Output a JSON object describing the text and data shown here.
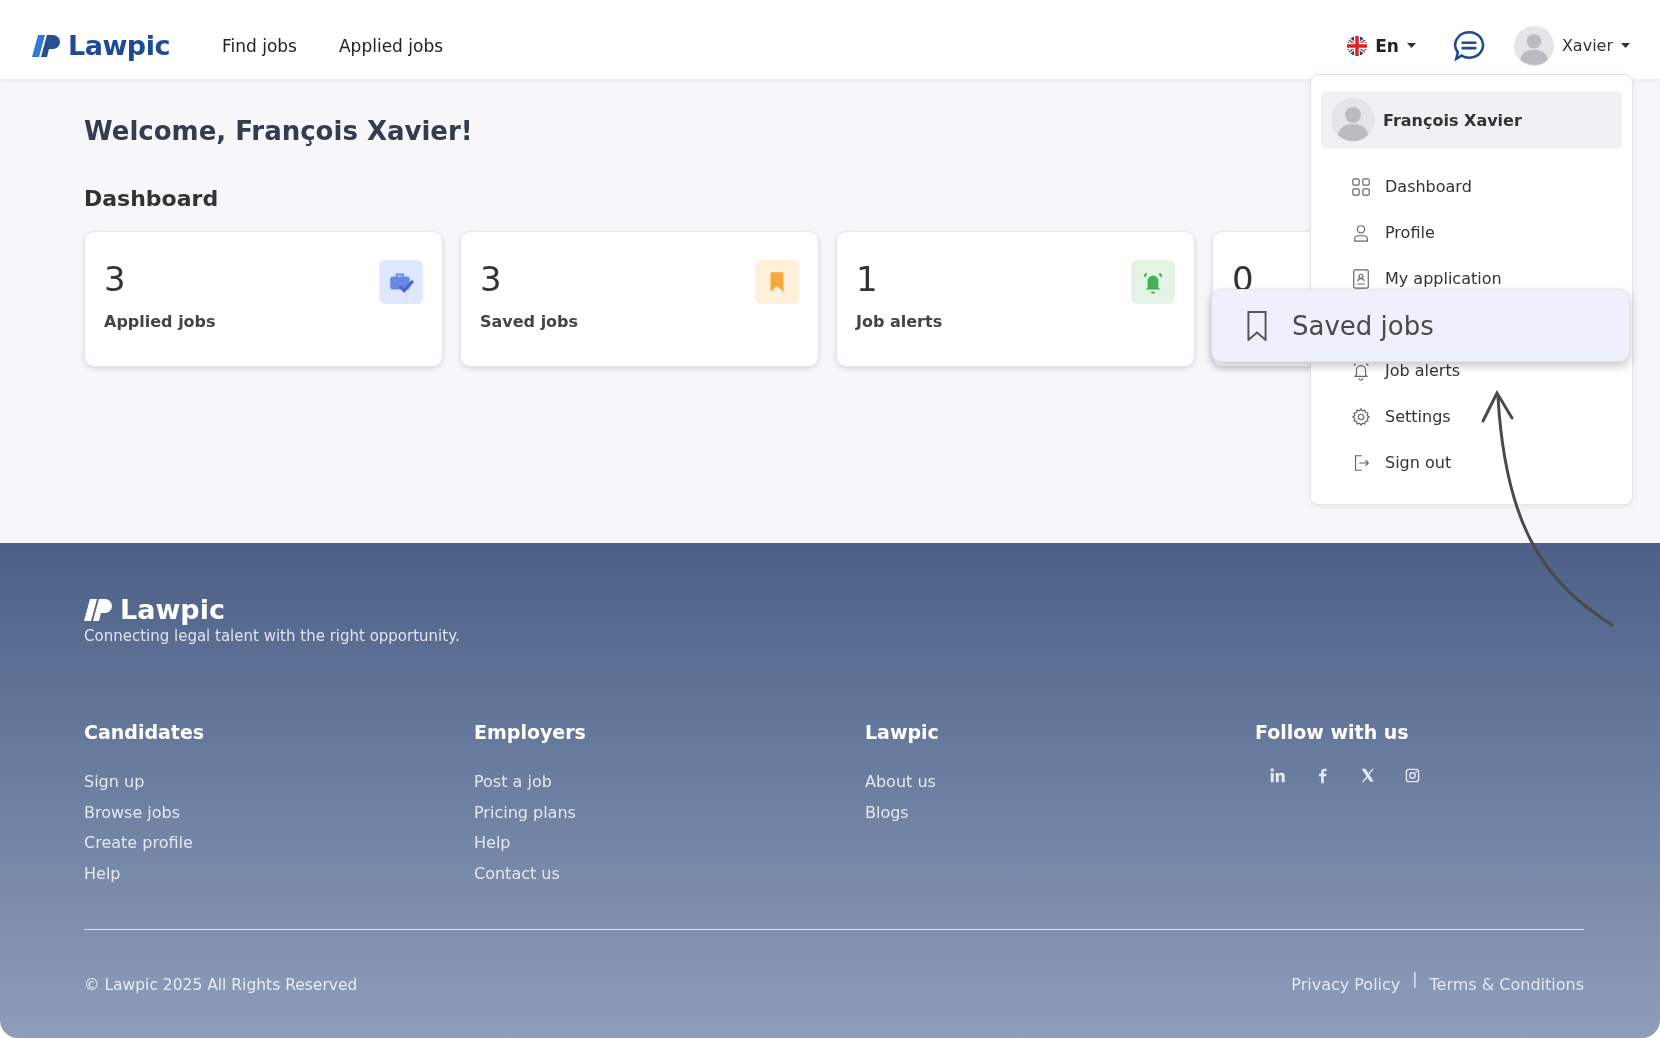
{
  "header": {
    "logo": "Lawpic",
    "nav": [
      "Find jobs",
      "Applied jobs"
    ],
    "language": "En",
    "user_name": "Xavier"
  },
  "welcome": "Welcome, François Xavier!",
  "dashboard": {
    "title": "Dashboard",
    "cards": [
      {
        "value": "3",
        "label": "Applied jobs",
        "kind": "briefcase"
      },
      {
        "value": "3",
        "label": "Saved jobs",
        "kind": "bookmark"
      },
      {
        "value": "1",
        "label": "Job alerts",
        "kind": "bell"
      },
      {
        "value": "0"
      }
    ]
  },
  "user_menu": {
    "name": "François Xavier",
    "items": [
      {
        "label": "Dashboard",
        "kind": "grid"
      },
      {
        "label": "Profile",
        "kind": "person"
      },
      {
        "label": "My application",
        "kind": "document"
      },
      {
        "kind": "hidden"
      },
      {
        "label": "Job alerts",
        "kind": "bell"
      },
      {
        "label": "Settings",
        "kind": "gear"
      },
      {
        "label": "Sign out",
        "kind": "exit"
      }
    ]
  },
  "callout": {
    "label": "Saved jobs"
  },
  "footer": {
    "logo": "Lawpic",
    "tagline": "Connecting legal talent with the right opportunity.",
    "columns": [
      {
        "title": "Candidates",
        "links": [
          "Sign up",
          "Browse jobs",
          "Create profile",
          "Help"
        ]
      },
      {
        "title": "Employers",
        "links": [
          "Post a job",
          "Pricing plans",
          "Help",
          "Contact us"
        ]
      },
      {
        "title": "Lawpic",
        "links": [
          "About us",
          "Blogs"
        ]
      },
      {
        "title": "Follow with us",
        "social": [
          {
            "kind": "linkedin"
          },
          {
            "kind": "facebook"
          },
          {
            "kind": "x"
          },
          {
            "kind": "instagram"
          }
        ]
      }
    ],
    "copyright": "© Lawpic 2025 All Rights Reserved",
    "legal": [
      "Privacy Policy",
      "Terms & Conditions"
    ],
    "separator": "|"
  }
}
